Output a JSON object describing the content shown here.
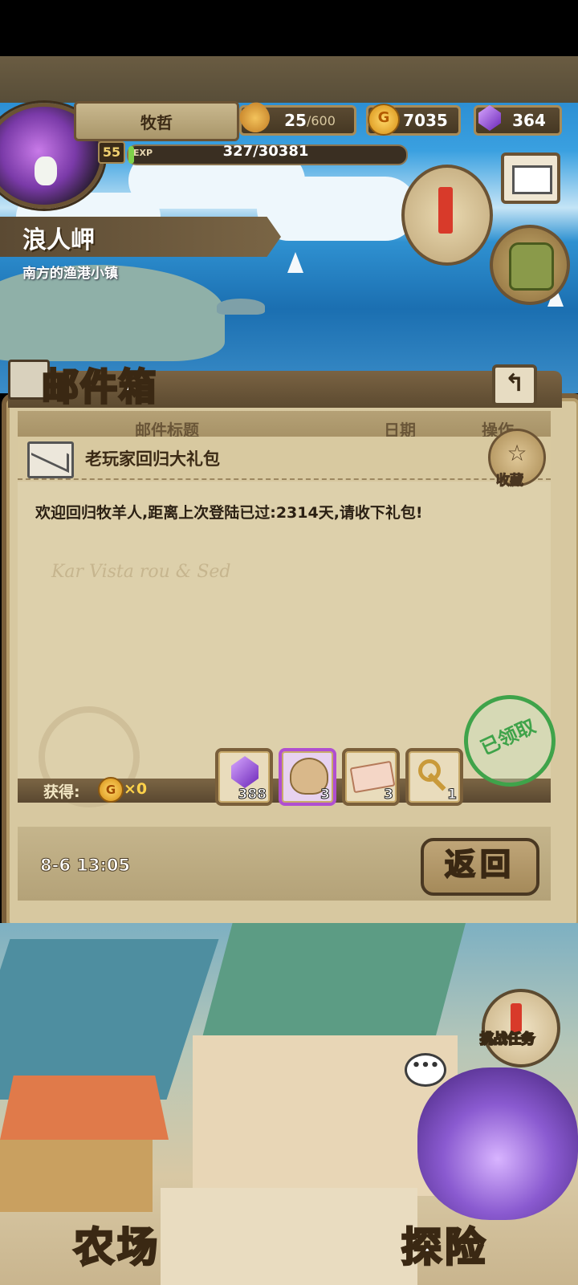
{
  "hud": {
    "player_name": "牧哲",
    "level": "55",
    "exp_label": "EXP",
    "exp_text": "327/30381",
    "exp_progress": 0.0108,
    "bread_value": "25",
    "bread_max": "/600",
    "gold_value": "7035",
    "gold_symbol": "G",
    "gem_value": "364"
  },
  "location": {
    "name": "浪人岬",
    "subtitle": "南方的渔港小镇"
  },
  "mailbox": {
    "title": "邮件箱",
    "back_arrow": "↰",
    "columns": [
      "邮件标题",
      "日期",
      "操作"
    ],
    "subject": "老玩家回归大礼包",
    "favorite_label": "收藏",
    "favorite_icon": "☆",
    "body": "欢迎回归牧羊人,距离上次登陆已过:2314天,请收下礼包!",
    "map_text": "Kar Vista rou & Sed",
    "claimed_stamp": "已领取",
    "obtain_label": "获得:",
    "obtain_coin_symbol": "G",
    "obtain_count": "×0",
    "rewards": [
      {
        "icon": "purple-gem-icon",
        "count": "388"
      },
      {
        "icon": "sack-icon",
        "count": "3"
      },
      {
        "icon": "ticket-icon",
        "count": "3"
      },
      {
        "icon": "key-icon",
        "count": "1"
      }
    ],
    "date": "8-6 13:05",
    "return_button": "返回"
  },
  "town": {
    "challenge_task_label": "挑战任务",
    "chat_bubble": "•••",
    "farm_label": "农场",
    "explore_label": "探险"
  },
  "colors": {
    "panel_bg": "#d7c8a0",
    "panel_border": "#7a5f3a",
    "stamp_green": "#3fa34a",
    "gold": "#ffd24a"
  }
}
